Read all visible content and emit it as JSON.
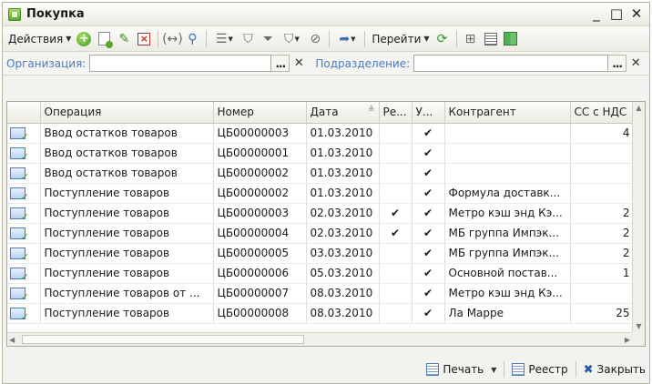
{
  "window": {
    "title": "Покупка"
  },
  "toolbar": {
    "actions_label": "Действия",
    "goto_label": "Перейти"
  },
  "filters": {
    "org_label": "Организация:",
    "org_value": "",
    "dept_label": "Подразделение:",
    "dept_value": ""
  },
  "table": {
    "columns": [
      "",
      "Операция",
      "Номер",
      "Дата",
      "Ре...",
      "У...",
      "Контрагент",
      "СС с НДС"
    ],
    "rows": [
      {
        "op": "Ввод остатков товаров",
        "num": "ЦБ00000003",
        "date": "01.03.2010",
        "re": "",
        "u": "✔",
        "kontr": "",
        "ss": "4"
      },
      {
        "op": "Ввод остатков товаров",
        "num": "ЦБ00000001",
        "date": "01.03.2010",
        "re": "",
        "u": "✔",
        "kontr": "",
        "ss": ""
      },
      {
        "op": "Ввод остатков товаров",
        "num": "ЦБ00000002",
        "date": "01.03.2010",
        "re": "",
        "u": "✔",
        "kontr": "",
        "ss": ""
      },
      {
        "op": "Поступление товаров",
        "num": "ЦБ00000002",
        "date": "01.03.2010",
        "re": "",
        "u": "✔",
        "kontr": "Формула доставк...",
        "ss": ""
      },
      {
        "op": "Поступление товаров",
        "num": "ЦБ00000003",
        "date": "02.03.2010",
        "re": "✔",
        "u": "✔",
        "kontr": "Метро кэш энд Кэ...",
        "ss": "2"
      },
      {
        "op": "Поступление товаров",
        "num": "ЦБ00000004",
        "date": "02.03.2010",
        "re": "✔",
        "u": "✔",
        "kontr": "МБ группа Импэк...",
        "ss": "2"
      },
      {
        "op": "Поступление товаров",
        "num": "ЦБ00000005",
        "date": "03.03.2010",
        "re": "",
        "u": "✔",
        "kontr": "МБ группа Импэк...",
        "ss": "2"
      },
      {
        "op": "Поступление товаров",
        "num": "ЦБ00000006",
        "date": "05.03.2010",
        "re": "",
        "u": "✔",
        "kontr": "Основной постав...",
        "ss": "1"
      },
      {
        "op": "Поступление товаров от ...",
        "num": "ЦБ00000007",
        "date": "08.03.2010",
        "re": "",
        "u": "✔",
        "kontr": "Метро кэш энд Кэ...",
        "ss": ""
      },
      {
        "op": "Поступление товаров",
        "num": "ЦБ00000008",
        "date": "08.03.2010",
        "re": "",
        "u": "✔",
        "kontr": "Ла Марре",
        "ss": "25"
      }
    ]
  },
  "bottom": {
    "print_label": "Печать",
    "registry_label": "Реестр",
    "close_label": "Закрыть"
  }
}
